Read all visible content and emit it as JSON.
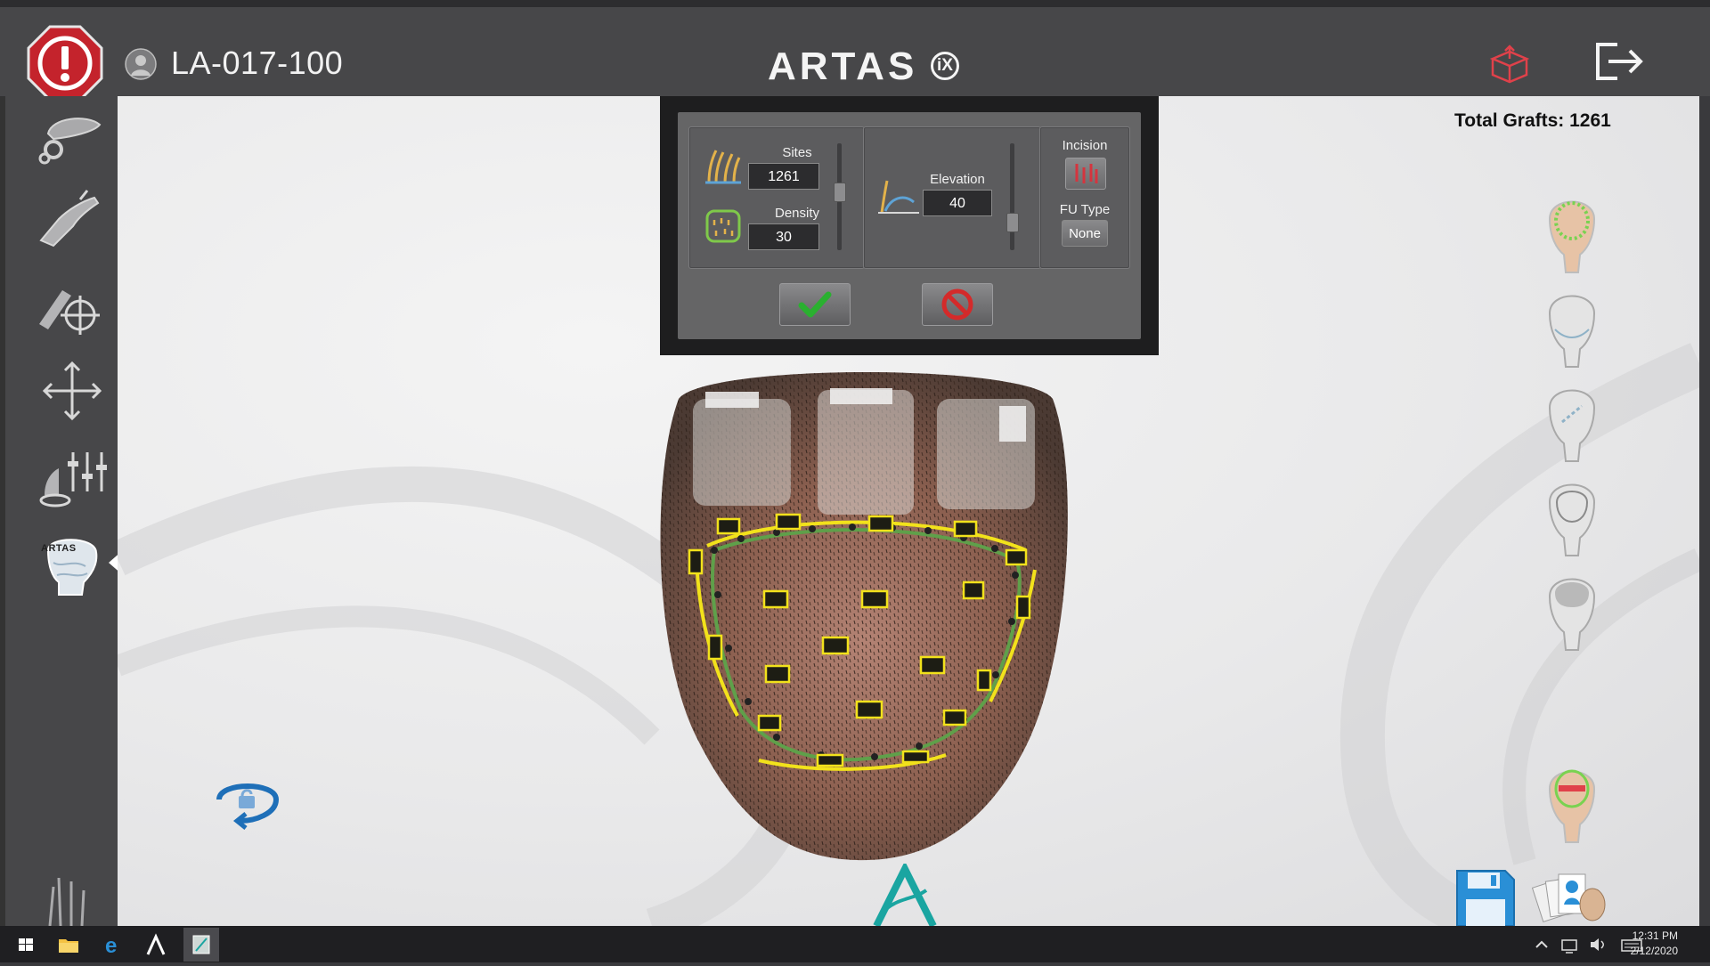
{
  "header": {
    "patient_id": "LA-017-100",
    "brand": "ARTAS",
    "brand_suffix": "iX"
  },
  "workspace": {
    "total_grafts_label": "Total Grafts: 1261"
  },
  "dialog": {
    "sites_label": "Sites",
    "sites_value": "1261",
    "density_label": "Density",
    "density_value": "30",
    "elevation_label": "Elevation",
    "elevation_value": "40",
    "incision_label": "Incision",
    "fu_type_label": "FU Type",
    "fu_type_value": "None"
  },
  "sidebar": {
    "mini_brand": "ARTAS"
  },
  "taskbar": {
    "time": "12:31 PM",
    "date": "2/12/2020"
  },
  "colors": {
    "topbar": "#474749",
    "alert_red": "#c4232c",
    "accent_teal": "#1aa5a1",
    "accent_red": "#e0414a",
    "save_blue": "#2a8fd6",
    "boundary_yellow": "#f2e21b",
    "boundary_green": "#5fa04a"
  }
}
